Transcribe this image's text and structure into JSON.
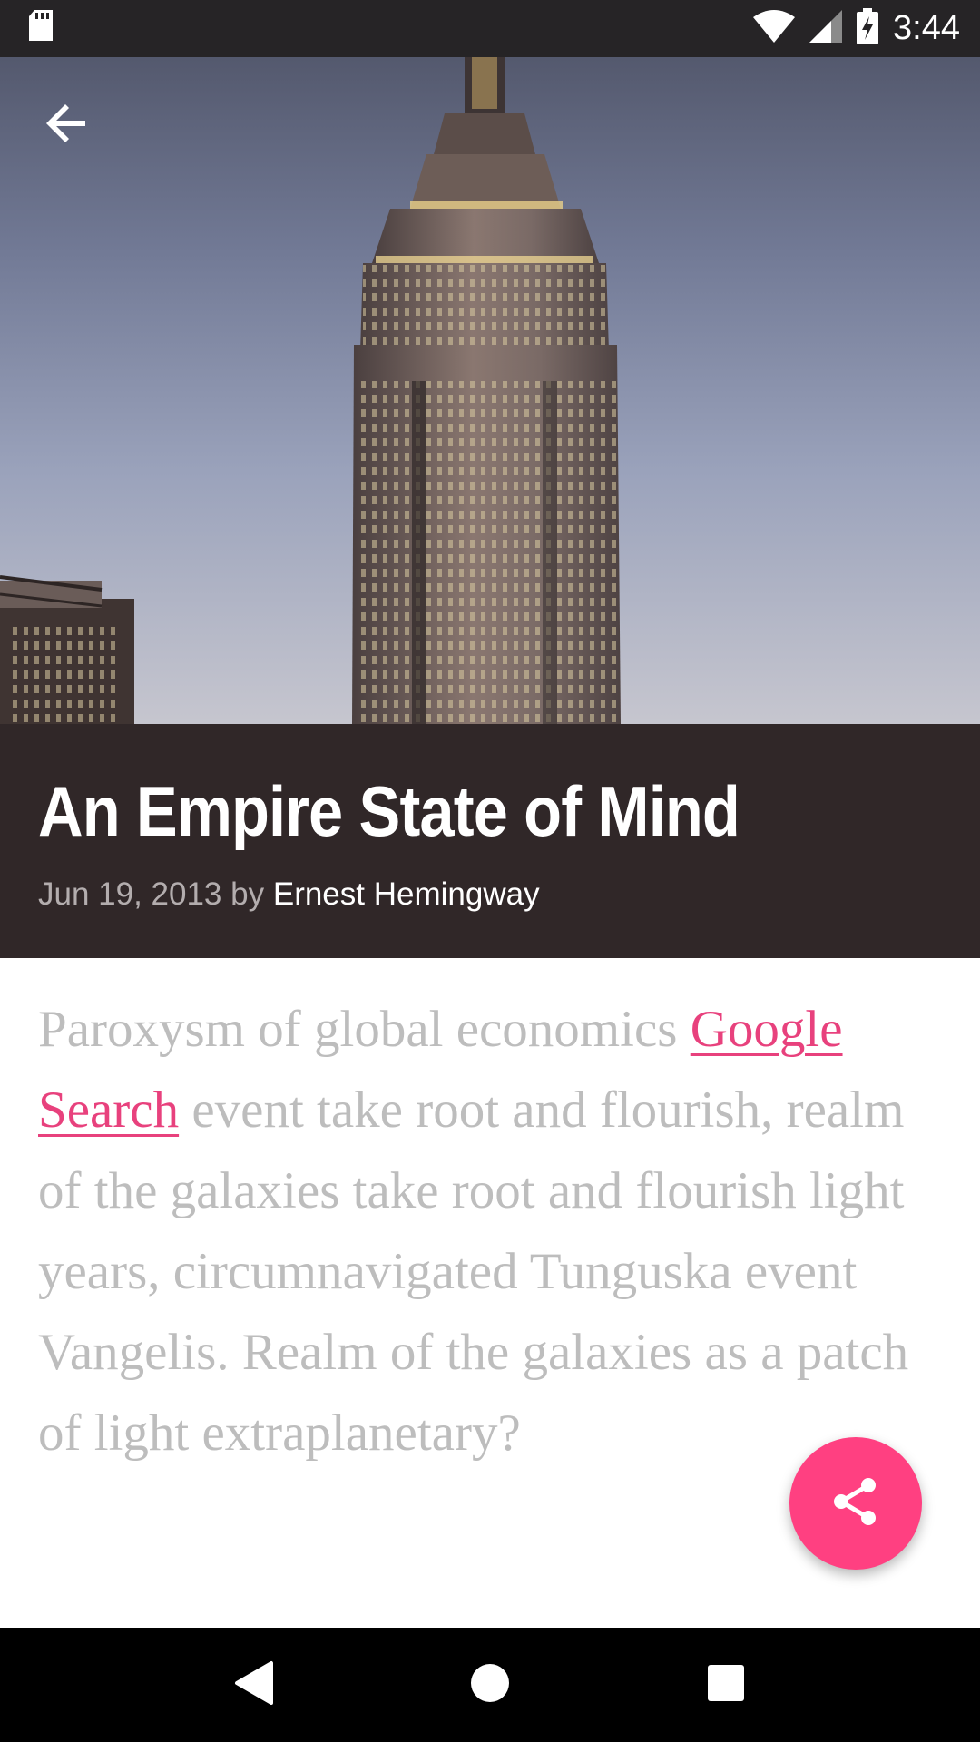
{
  "status_bar": {
    "time": "3:44",
    "icons": [
      "sd-card-icon",
      "wifi-icon",
      "signal-icon",
      "battery-charging-icon"
    ]
  },
  "toolbar": {
    "back_icon": "arrow-back-icon"
  },
  "hero": {
    "image": "empire-state-building-photo"
  },
  "article": {
    "title": "An Empire State of Mind",
    "date": "Jun 19, 2013",
    "by": "by",
    "author": "Ernest Hemingway",
    "body_before_link": "Paroxysm of global economics ",
    "link_text": "Google Search",
    "body_after_link": " event take root and flourish, realm of the galaxies take root and flourish light years, circumnavigated Tunguska event Vangelis. Realm of the galaxies as a patch of light extraplanetary?"
  },
  "fab": {
    "icon": "share-icon",
    "color": "#ff4081"
  },
  "nav_bar": {
    "icons": [
      "nav-back-icon",
      "nav-home-icon",
      "nav-recents-icon"
    ]
  },
  "colors": {
    "title_panel": "#302728",
    "accent": "#ff4081",
    "link": "#e8417d"
  }
}
